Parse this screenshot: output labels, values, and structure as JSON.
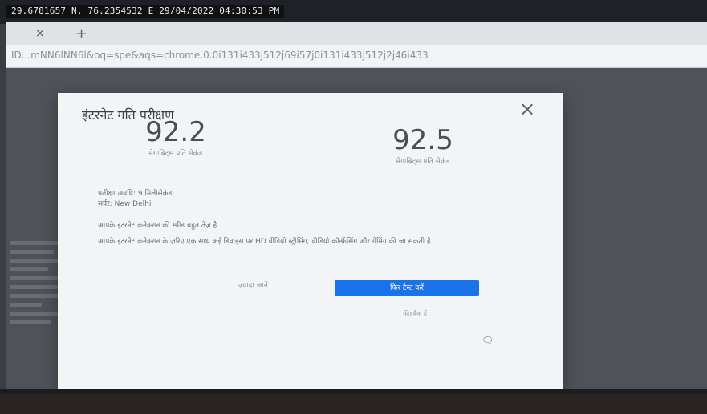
{
  "photo": {
    "gps_stamp": "29.6781657 N, 76.2354532 E  29/04/2022 04:30:53 PM"
  },
  "browser": {
    "tab_close_glyph": "×",
    "new_tab_glyph": "+",
    "url": "ID...mNN6lNN6l&oq=spe&aqs=chrome.0.0i131i433j512j69i57j0i131i433j512j2j46i433"
  },
  "dialog": {
    "title": "इंटरनेट गति परीक्षण",
    "close_glyph": "×",
    "download": {
      "value": "92.2",
      "label": "मेगाबिट्स प्रति सेकंड"
    },
    "upload": {
      "value": "92.5",
      "label": "मेगाबिट्स प्रति सेकंड"
    },
    "latency_line": "प्रतीक्षा अवधि: 9 मिलीसेकंड",
    "server_line": "सर्वर: New Delhi",
    "status_line": "आपके इंटरनेट कनेक्शन की स्पीड बहुत तेज़ है",
    "description": "आपके इंटरनेट कनेक्शन के ज़रिए एक साथ कई डिवाइस पर HD वीडियो स्ट्रीमिंग, वीडियो कॉन्फ़्रेंसिंग और गेमिंग की जा सकती है",
    "more_link": "ज़्यादा जानें",
    "retry_button": "फिर टेस्ट करें",
    "feedback_link": "फ़ीडबैक दें",
    "corner_icon": "chat-icon"
  }
}
